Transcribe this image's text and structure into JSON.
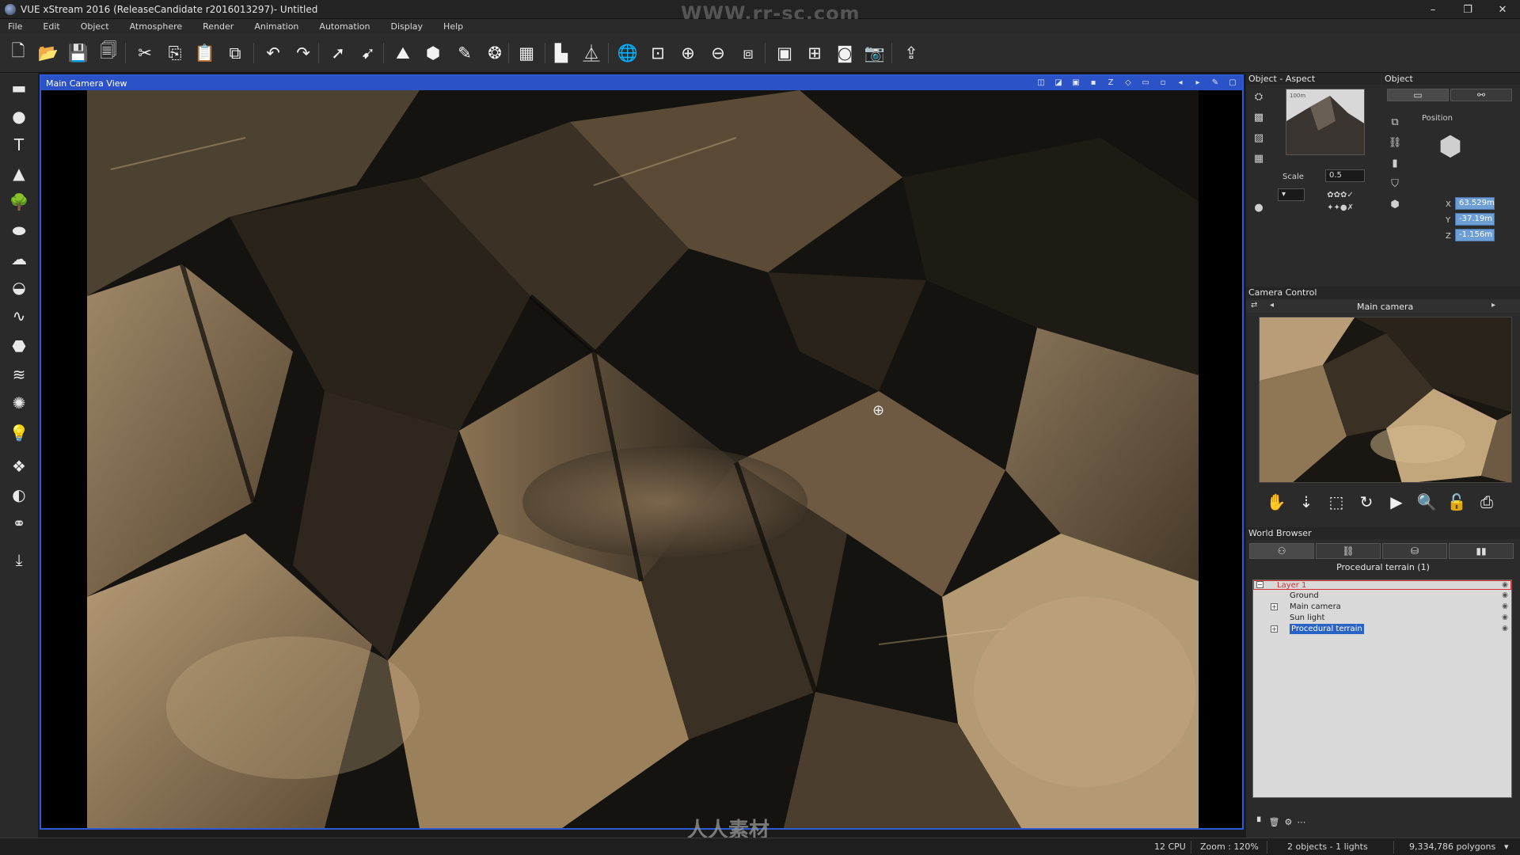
{
  "window": {
    "title": "VUE xStream 2016 (ReleaseCandidate r2016013297)- Untitled",
    "watermark_top": "WWW.rr-sc.com",
    "controls": [
      "–",
      "❐",
      "✕"
    ]
  },
  "menu": [
    "File",
    "Edit",
    "Object",
    "Atmosphere",
    "Render",
    "Animation",
    "Automation",
    "Display",
    "Help"
  ],
  "toolbar_icons": [
    {
      "name": "new-file-icon",
      "glyph": "🗋"
    },
    {
      "name": "open-file-icon",
      "glyph": "📂"
    },
    {
      "name": "save-icon",
      "glyph": "💾"
    },
    {
      "name": "save-as-icon",
      "glyph": "🗐"
    },
    {
      "name": "cut-icon",
      "glyph": "✂"
    },
    {
      "name": "copy-icon",
      "glyph": "⎘"
    },
    {
      "name": "paste-icon",
      "glyph": "📋"
    },
    {
      "name": "duplicate-icon",
      "glyph": "⧉"
    },
    {
      "name": "undo-icon",
      "glyph": "↶"
    },
    {
      "name": "redo-icon",
      "glyph": "↷"
    },
    {
      "name": "select-icon",
      "glyph": "➚"
    },
    {
      "name": "select-multiple-icon",
      "glyph": "➹"
    },
    {
      "name": "terrain-editor-icon",
      "glyph": "⛰"
    },
    {
      "name": "object-editor-icon",
      "glyph": "⬢"
    },
    {
      "name": "material-editor-icon",
      "glyph": "✎"
    },
    {
      "name": "material-library-icon",
      "glyph": "❂"
    },
    {
      "name": "ecosystem-icon",
      "glyph": "▦"
    },
    {
      "name": "align-icon",
      "glyph": "▙"
    },
    {
      "name": "mirror-icon",
      "glyph": "⏅"
    },
    {
      "name": "globe-icon",
      "glyph": "🌐"
    },
    {
      "name": "zoom-fit-icon",
      "glyph": "⊡"
    },
    {
      "name": "zoom-in-icon",
      "glyph": "⊕"
    },
    {
      "name": "zoom-out-icon",
      "glyph": "⊖"
    },
    {
      "name": "layout-icon",
      "glyph": "⧈"
    },
    {
      "name": "render-area-icon",
      "glyph": "▣"
    },
    {
      "name": "render-display-icon",
      "glyph": "⊞"
    },
    {
      "name": "render-options-icon",
      "glyph": "◙"
    },
    {
      "name": "render-camera-icon",
      "glyph": "📷"
    },
    {
      "name": "export-icon",
      "glyph": "⇪"
    }
  ],
  "left_tools": [
    {
      "name": "water-plane-icon",
      "glyph": "▬"
    },
    {
      "name": "sphere-icon",
      "glyph": "●"
    },
    {
      "name": "text-icon",
      "glyph": "T"
    },
    {
      "name": "terrain-icon",
      "glyph": "▲"
    },
    {
      "name": "plant-icon",
      "glyph": "🌳"
    },
    {
      "name": "rock-icon",
      "glyph": "⬬"
    },
    {
      "name": "cloud-icon",
      "glyph": "☁"
    },
    {
      "name": "planet-icon",
      "glyph": "◒"
    },
    {
      "name": "spline-icon",
      "glyph": "∿"
    },
    {
      "name": "import-object-icon",
      "glyph": "⬣"
    },
    {
      "name": "wind-icon",
      "glyph": "≋"
    },
    {
      "name": "fan-icon",
      "glyph": "✺"
    },
    {
      "name": "light-icon",
      "glyph": "💡"
    },
    {
      "name": "group-icon",
      "glyph": "❖"
    },
    {
      "name": "boolean-icon",
      "glyph": "◐"
    },
    {
      "name": "metablob-icon",
      "glyph": "⚭"
    },
    {
      "name": "drop-icon",
      "glyph": "⤓"
    }
  ],
  "viewport": {
    "title": "Main Camera View",
    "header_icons": [
      "◫",
      "◪",
      "▣",
      "▪",
      "Z",
      "◇",
      "▭",
      "▫",
      "◂",
      "▸",
      "✎",
      "▢"
    ],
    "border_color": "#2d5bd8"
  },
  "object_aspect": {
    "title": "Object - Aspect",
    "scale_label": "Scale",
    "scale_value": "0.5",
    "thumb_caption": "100m"
  },
  "object_panel": {
    "title": "Object",
    "position_label": "Position",
    "x_label": "X",
    "x_value": "63.529m",
    "y_label": "Y",
    "y_value": "-37.19m",
    "z_label": "Z",
    "z_value": "-1.156m"
  },
  "camera_control": {
    "title": "Camera Control",
    "camera_name": "Main camera",
    "tools": [
      {
        "name": "pan-hand-icon",
        "glyph": "✋"
      },
      {
        "name": "dolly-icon",
        "glyph": "⇣"
      },
      {
        "name": "frame-icon",
        "glyph": "⬚"
      },
      {
        "name": "rotate-icon",
        "glyph": "↻"
      },
      {
        "name": "play-icon",
        "glyph": "▶"
      },
      {
        "name": "camera-zoom-icon",
        "glyph": "🔍"
      },
      {
        "name": "lock-icon",
        "glyph": "🔓"
      },
      {
        "name": "camera-snapshot-icon",
        "glyph": "⎙"
      }
    ]
  },
  "world_browser": {
    "title": "World Browser",
    "tabs": [
      "⚇",
      "⛓",
      "⛁",
      "▮▮"
    ],
    "selection_label": "Procedural terrain (1)",
    "tree": [
      {
        "label": "Layer 1",
        "kind": "layer"
      },
      {
        "label": "Ground",
        "kind": "item"
      },
      {
        "label": "Main camera",
        "kind": "item"
      },
      {
        "label": "Sun light",
        "kind": "item"
      },
      {
        "label": "Procedural terrain",
        "kind": "selected"
      }
    ],
    "footer_icons": [
      "▘",
      "🗑",
      "⚙",
      "⋯"
    ]
  },
  "status": {
    "cpu": "12 CPU",
    "zoom": "Zoom : 120%",
    "objects": "2 objects - 1 lights",
    "polygons": "9,334,786 polygons"
  },
  "watermark_bottom": "人人素材",
  "colors": {
    "accent_blue": "#2c52c7",
    "panel_bg": "#2b2b2b",
    "tree_bg": "#d9d9d9",
    "selection": "#2a63c6"
  }
}
